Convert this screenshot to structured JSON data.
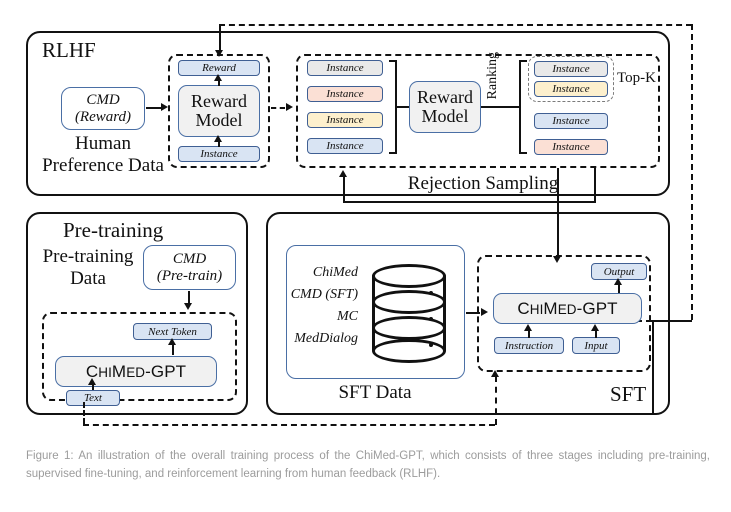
{
  "figure": {
    "caption": "Figure 1: An illustration of the overall training process of the ChiMed-GPT, which consists of three stages including pre-training, supervised fine-tuning, and reinforcement learning from human feedback (RLHF)."
  },
  "colors": {
    "blue_fill": "#d9e4f3",
    "grey_fill": "#e9e9e9",
    "pink_fill": "#fbe0d5",
    "yellow_fill": "#fdf0cd",
    "model_fill": "#f1f1f1",
    "blue_stroke": "#4a6fa5",
    "stroke": "#111111",
    "caption_text": "#9c9c9c"
  },
  "rlhf": {
    "title": "RLHF",
    "data_source": {
      "box_line1": "CMD",
      "box_line2": "(Reward)",
      "label_line1": "Human",
      "label_line2": "Preference Data"
    },
    "reward_training": {
      "top_chip": "Reward",
      "model": "Reward Model",
      "model_line1": "Reward",
      "model_line2": "Model",
      "bottom_chip": "Instance"
    },
    "sampling": {
      "label": "Rejection Sampling",
      "ranking_label": "Ranking",
      "topk_label": "Top-K",
      "model_line1": "Reward",
      "model_line2": "Model",
      "candidates": [
        {
          "text": "Instance",
          "color": "grey"
        },
        {
          "text": "Instance",
          "color": "pink"
        },
        {
          "text": "Instance",
          "color": "yellow"
        },
        {
          "text": "Instance",
          "color": "blue"
        }
      ],
      "ranked": [
        {
          "text": "Instance",
          "color": "grey",
          "topk": true
        },
        {
          "text": "Instance",
          "color": "yellow",
          "topk": true
        },
        {
          "text": "Instance",
          "color": "blue",
          "topk": false
        },
        {
          "text": "Instance",
          "color": "pink",
          "topk": false
        }
      ]
    }
  },
  "pretraining": {
    "title": "Pre-training",
    "data_label_line1": "Pre-training",
    "data_label_line2": "Data",
    "cmd_line1": "CMD",
    "cmd_line2": "(Pre-train)",
    "next_token_chip": "Next Token",
    "model": "ChiMed-GPT",
    "model_prefix": "C",
    "model_mid1": "HI",
    "model_mid2": "M",
    "model_mid3": "ED",
    "model_suffix": "-GPT",
    "text_chip": "Text"
  },
  "sft": {
    "title": "SFT",
    "data_label": "SFT Data",
    "datasets": [
      "ChiMed",
      "CMD (SFT)",
      "MC",
      "MedDialog"
    ],
    "model": "ChiMed-GPT",
    "output_chip": "Output",
    "instruction_chip": "Instruction",
    "input_chip": "Input"
  }
}
